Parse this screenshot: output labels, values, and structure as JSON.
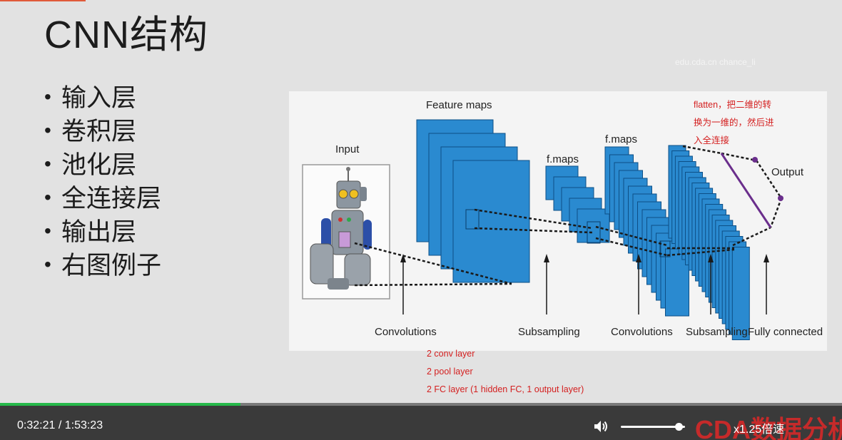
{
  "slide": {
    "title": "CNN结构",
    "bullets": [
      "输入层",
      "卷积层",
      "池化层",
      "全连接层",
      "输出层",
      "右图例子"
    ],
    "watermark": "edu.cda.cn chance_li"
  },
  "figure": {
    "labels": {
      "input": "Input",
      "feature_maps": "Feature maps",
      "fmaps_1": "f.maps",
      "fmaps_2": "f.maps",
      "output": "Output",
      "convolutions_1": "Convolutions",
      "subsampling_1": "Subsampling",
      "convolutions_2": "Convolutions",
      "subsampling_2": "Subsampling",
      "fully_connected": "Fully connected"
    },
    "colors": {
      "map_fill": "#2a8ad0",
      "map_stroke": "#0d4f86",
      "output_line": "#6a2e8c"
    }
  },
  "notes": {
    "flatten": [
      "flatten，把二维的转",
      "换为一维的，然后进",
      "入全连接"
    ],
    "layers": [
      "2 conv layer",
      "2 pool layer",
      "2 FC layer (1 hidden FC, 1 output layer)"
    ]
  },
  "player": {
    "time": "0:32:21 / 1:53:23",
    "progress": 0.286,
    "volume": 0.9,
    "speed": "x1.25倍速",
    "logo_text": "CDA数据分析",
    "icons": {
      "volume": "volume-icon"
    },
    "colors": {
      "progress": "#26b84a",
      "bar": "#3a3a3a"
    }
  }
}
